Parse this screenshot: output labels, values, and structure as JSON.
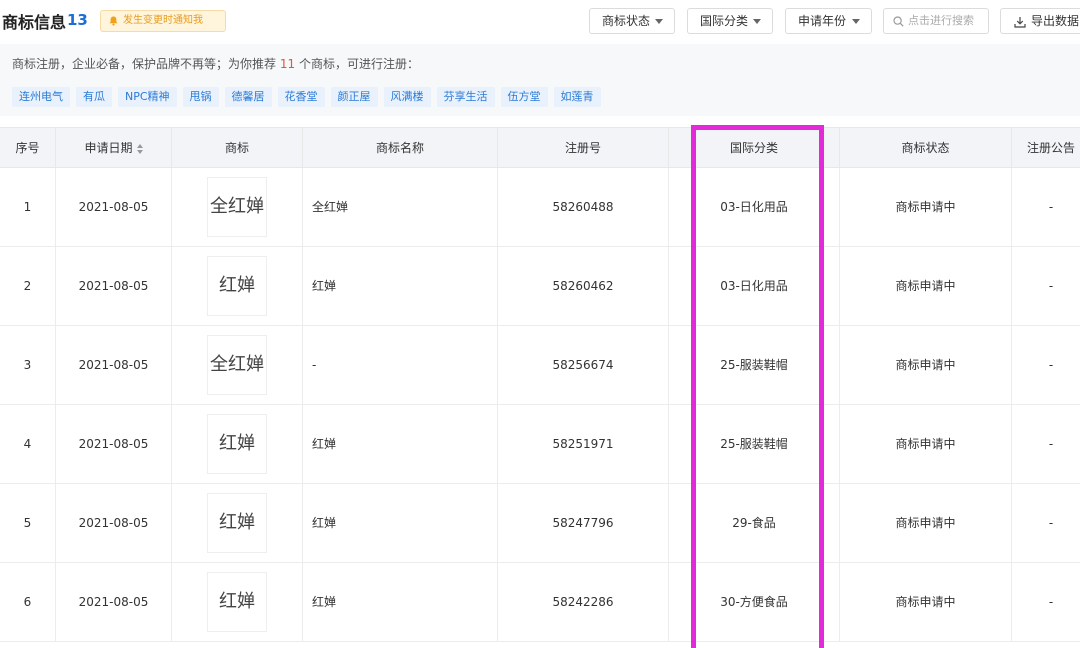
{
  "header": {
    "title": "商标信息",
    "count": "13",
    "notify_label": "发生变更时通知我",
    "filters": [
      {
        "label": "商标状态"
      },
      {
        "label": "国际分类"
      },
      {
        "label": "申请年份"
      }
    ],
    "search_placeholder": "点击进行搜索",
    "export_label": "导出数据"
  },
  "recommend": {
    "text_prefix": "商标注册，企业必备，保护品牌不再等；为你推荐",
    "count": "11",
    "text_suffix": "个商标，可进行注册：",
    "tags": [
      "连州电气",
      "有瓜",
      "NPC精神",
      "甩锅",
      "德馨居",
      "花香堂",
      "颜正屋",
      "风满楼",
      "芬享生活",
      "伍方堂",
      "如莲青"
    ]
  },
  "table": {
    "columns": [
      "序号",
      "申请日期",
      "商标",
      "商标名称",
      "注册号",
      "国际分类",
      "商标状态",
      "注册公告"
    ],
    "rows": [
      {
        "index": "1",
        "date": "2021-08-05",
        "logo": "全红婵",
        "name": "全红婵",
        "reg_no": "58260488",
        "category": "03-日化用品",
        "status": "商标申请中",
        "notice": "-"
      },
      {
        "index": "2",
        "date": "2021-08-05",
        "logo": "红婵",
        "name": "红婵",
        "reg_no": "58260462",
        "category": "03-日化用品",
        "status": "商标申请中",
        "notice": "-"
      },
      {
        "index": "3",
        "date": "2021-08-05",
        "logo": "全红婵",
        "name": "-",
        "reg_no": "58256674",
        "category": "25-服装鞋帽",
        "status": "商标申请中",
        "notice": "-"
      },
      {
        "index": "4",
        "date": "2021-08-05",
        "logo": "红婵",
        "name": "红婵",
        "reg_no": "58251971",
        "category": "25-服装鞋帽",
        "status": "商标申请中",
        "notice": "-"
      },
      {
        "index": "5",
        "date": "2021-08-05",
        "logo": "红婵",
        "name": "红婵",
        "reg_no": "58247796",
        "category": "29-食品",
        "status": "商标申请中",
        "notice": "-"
      },
      {
        "index": "6",
        "date": "2021-08-05",
        "logo": "红婵",
        "name": "红婵",
        "reg_no": "58242286",
        "category": "30-方便食品",
        "status": "商标申请中",
        "notice": "-"
      }
    ]
  },
  "colors": {
    "accent": "#1a6fd6",
    "highlight": "#e22ad8",
    "recommend_count": "#e8542e"
  }
}
